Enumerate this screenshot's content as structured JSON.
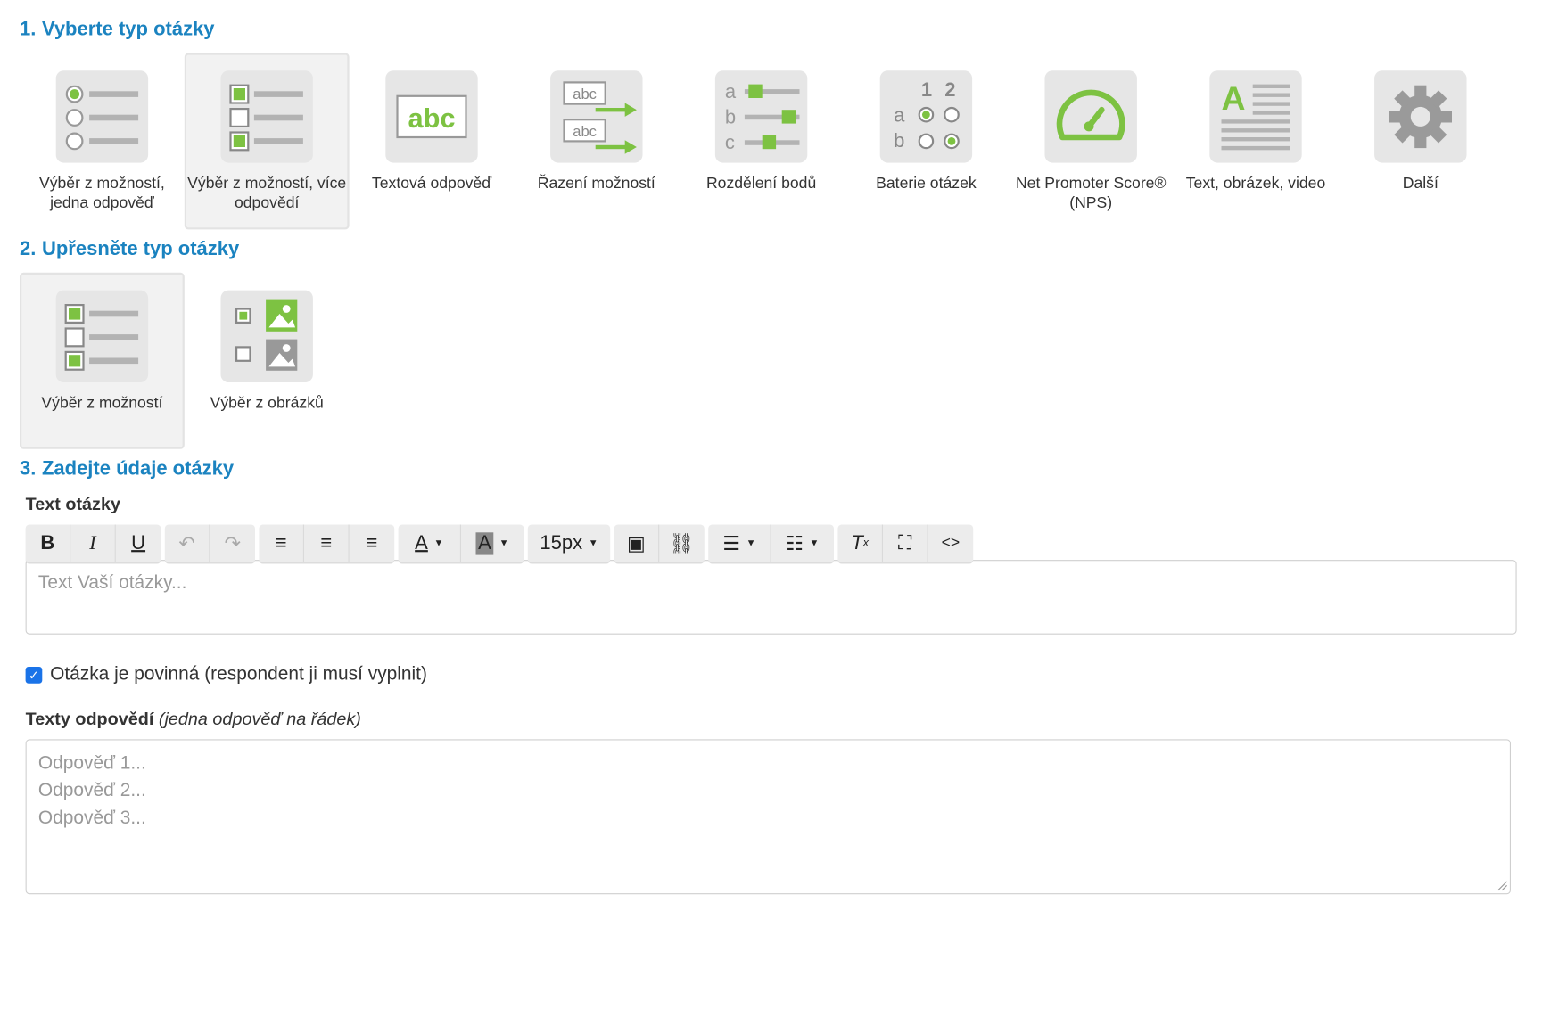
{
  "step1": {
    "num": "1.",
    "title": "Vyberte typ otázky",
    "types": [
      {
        "label": "Výběr z možností, jedna odpověď",
        "icon": "radio-list-icon"
      },
      {
        "label": "Výběr z možností, více odpovědí",
        "icon": "checkbox-list-icon",
        "selected": true
      },
      {
        "label": "Textová odpověď",
        "icon": "text-answer-icon"
      },
      {
        "label": "Řazení možností",
        "icon": "ordering-icon"
      },
      {
        "label": "Rozdělení bodů",
        "icon": "points-slider-icon"
      },
      {
        "label": "Baterie otázek",
        "icon": "matrix-icon"
      },
      {
        "label": "Net Promoter Score® (NPS)",
        "icon": "gauge-icon"
      },
      {
        "label": "Text, obrázek, video",
        "icon": "text-media-icon"
      },
      {
        "label": "Další",
        "icon": "gear-icon"
      }
    ]
  },
  "step2": {
    "num": "2.",
    "title": "Upřesněte typ otázky",
    "types": [
      {
        "label": "Výběr z možností",
        "icon": "checkbox-list-icon",
        "selected": true
      },
      {
        "label": "Výběr z obrázků",
        "icon": "image-choice-icon"
      }
    ]
  },
  "step3": {
    "num": "3.",
    "title": "Zadejte údaje otázky",
    "question_label": "Text otázky",
    "question_placeholder": "Text Vaší otázky...",
    "font_size": "15px",
    "required_label": "Otázka je povinná (respondent ji musí vyplnit)",
    "required_checked": true,
    "answers_label": "Texty odpovědí",
    "answers_hint": "(jedna odpověď na řádek)",
    "answers_placeholder": [
      "Odpověď 1...",
      "Odpověď 2...",
      "Odpověď 3..."
    ]
  },
  "colors": {
    "accent": "#1b83c0",
    "icon_green": "#7dc242",
    "icon_grey": "#b3b3b3"
  }
}
